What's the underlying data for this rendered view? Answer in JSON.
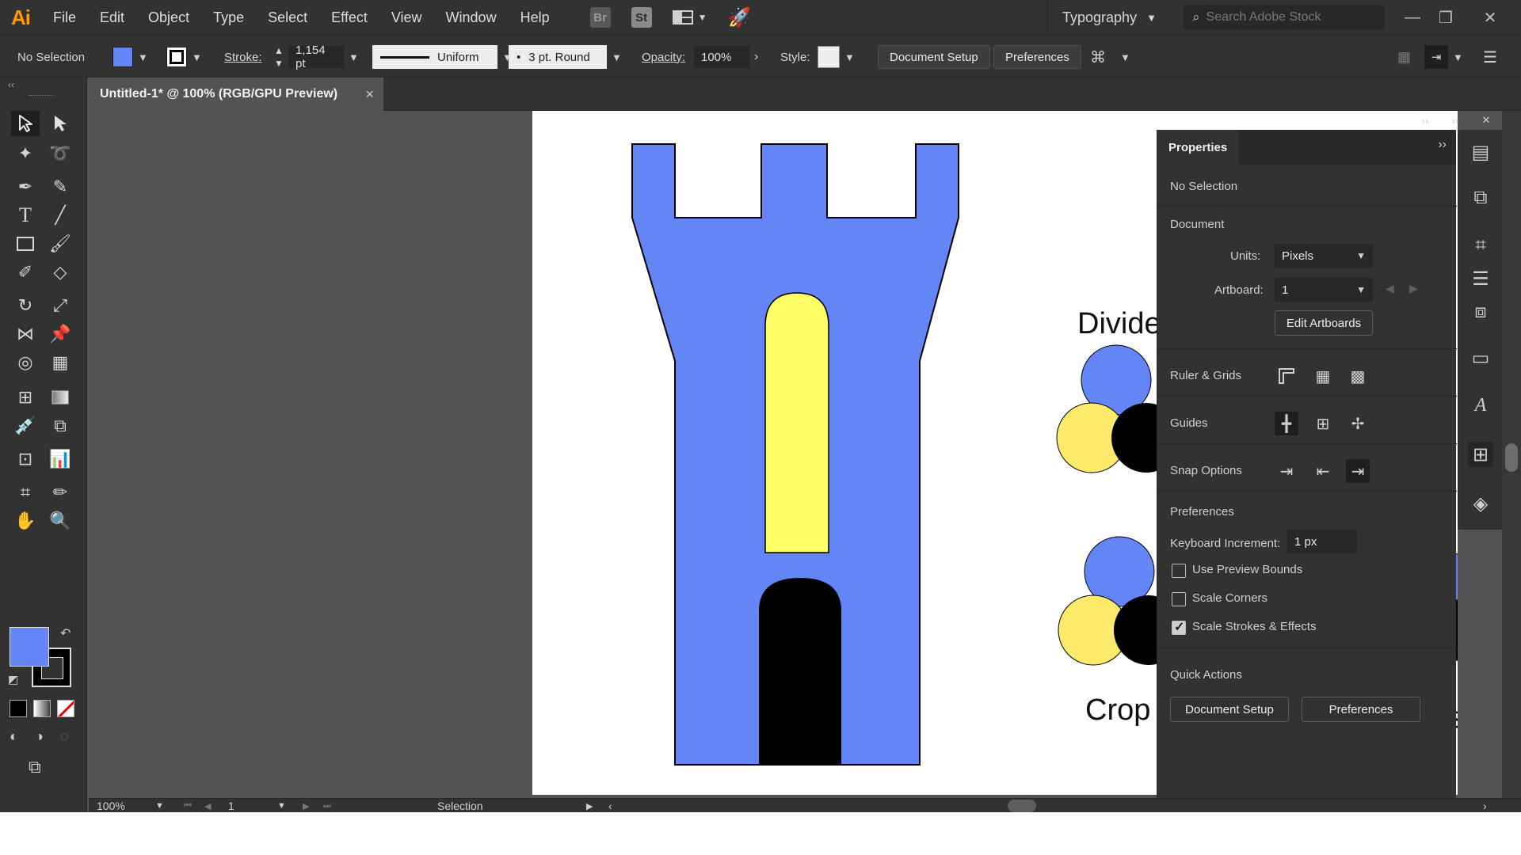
{
  "app": {
    "logo": "Ai"
  },
  "menu": [
    "File",
    "Edit",
    "Object",
    "Type",
    "Select",
    "Effect",
    "View",
    "Window",
    "Help"
  ],
  "menu_ext": {
    "bridge": "Br",
    "stock": "St"
  },
  "workspace": {
    "label": "Typography"
  },
  "stock_search": {
    "placeholder": "Search Adobe Stock"
  },
  "control": {
    "selection": "No Selection",
    "stroke_label": "Stroke:",
    "stroke_value": "1,154 pt",
    "profile": "Uniform",
    "brush": "3 pt. Round",
    "brush_dot": "•",
    "opacity_label": "Opacity:",
    "opacity_value": "100%",
    "style_label": "Style:",
    "document_setup": "Document Setup",
    "preferences": "Preferences"
  },
  "document": {
    "tab_title": "Untitled-1* @ 100% (RGB/GPU Preview)",
    "close": "×"
  },
  "artboard": {
    "label_divide": "Divide",
    "label_crop": "Crop",
    "label_partial": "s Ba"
  },
  "properties": {
    "tab": "Properties",
    "selection": "No Selection",
    "document_section": "Document",
    "units_label": "Units:",
    "units_value": "Pixels",
    "artboard_label": "Artboard:",
    "artboard_value": "1",
    "edit_artboards": "Edit Artboards",
    "ruler_grids": "Ruler & Grids",
    "guides": "Guides",
    "snap_options": "Snap Options",
    "preferences_section": "Preferences",
    "keyboard_increment_label": "Keyboard Increment:",
    "keyboard_increment_value": "1 px",
    "use_preview_bounds": "Use Preview Bounds",
    "scale_corners": "Scale Corners",
    "scale_strokes": "Scale Strokes & Effects",
    "quick_actions": "Quick Actions",
    "qa_document_setup": "Document Setup",
    "qa_preferences": "Preferences",
    "checkboxes": {
      "use_preview_bounds": false,
      "scale_corners": false,
      "scale_strokes": true
    }
  },
  "status": {
    "zoom": "100%",
    "artboard": "1",
    "tool": "Selection"
  },
  "colors": {
    "fill": "#6485f5",
    "stroke": "#000000",
    "tower": "#6485f5",
    "window": "#ffff66",
    "door": "#000000",
    "circle_blue": "#6485f5",
    "circle_yellow": "#fde96a",
    "circle_black": "#000000",
    "accent_logo": "#ff9a00"
  }
}
